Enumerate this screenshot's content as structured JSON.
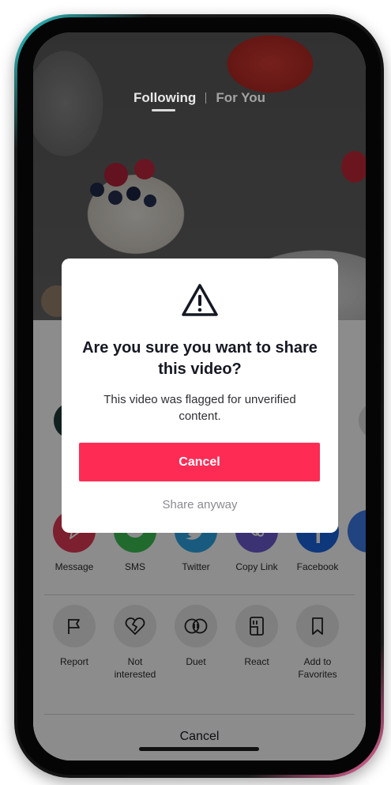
{
  "feed": {
    "tabs": [
      {
        "label": "Following"
      },
      {
        "label": "For You"
      }
    ]
  },
  "share_sheet": {
    "apps": [
      {
        "label": "Message",
        "icon": "message-icon",
        "color": "#e23a55"
      },
      {
        "label": "SMS",
        "icon": "sms-icon",
        "color": "#3cc155"
      },
      {
        "label": "Twitter",
        "icon": "twitter-icon",
        "color": "#2fa6e6"
      },
      {
        "label": "Copy Link",
        "icon": "link-icon",
        "color": "#6b5bd2"
      },
      {
        "label": "Facebook",
        "icon": "facebook-icon",
        "color": "#1b66e0"
      }
    ],
    "actions": [
      {
        "label": "Report",
        "icon": "flag-icon"
      },
      {
        "label": "Not interested",
        "icon": "broken-heart-icon"
      },
      {
        "label": "Duet",
        "icon": "duet-icon"
      },
      {
        "label": "React",
        "icon": "react-icon"
      },
      {
        "label": "Add to Favorites",
        "icon": "bookmark-icon"
      }
    ],
    "cancel_label": "Cancel"
  },
  "dialog": {
    "icon": "warning-icon",
    "title": "Are you sure you want to share this video?",
    "message": "This video was flagged for unverified content.",
    "primary_label": "Cancel",
    "secondary_label": "Share anyway",
    "primary_color": "#fe2c55"
  }
}
